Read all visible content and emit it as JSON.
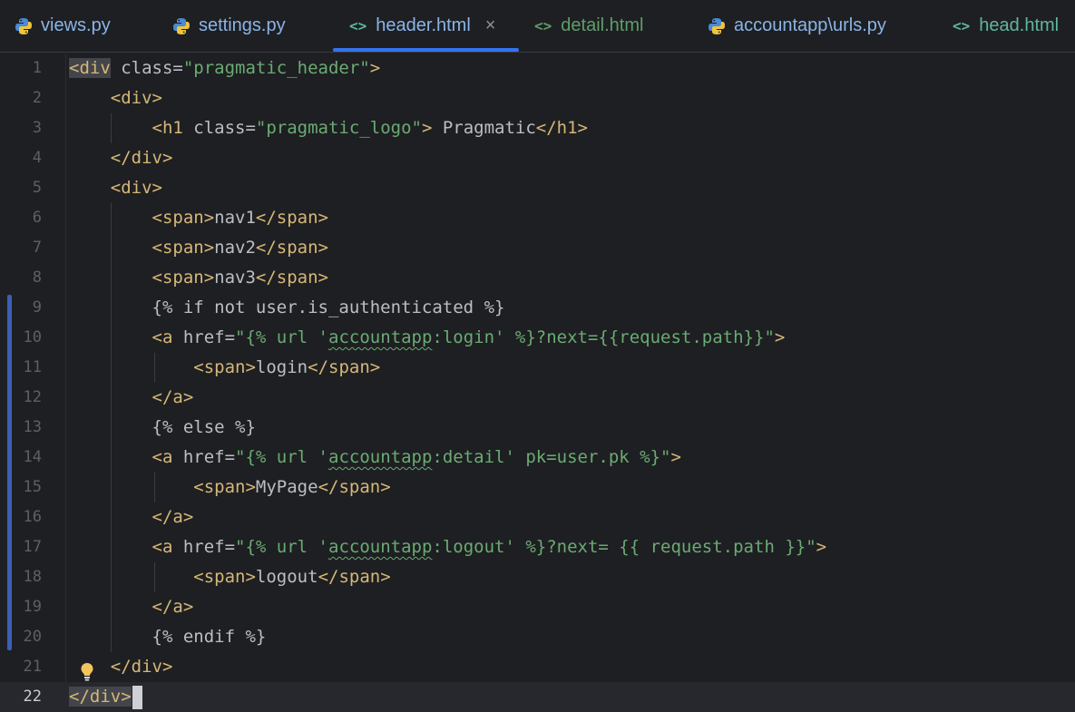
{
  "tabs": [
    {
      "label": "views.py",
      "icon": "python-icon"
    },
    {
      "label": "settings.py",
      "icon": "python-icon"
    },
    {
      "label": "header.html",
      "icon": "html-icon",
      "active": true,
      "close": "×"
    },
    {
      "label": "detail.html",
      "icon": "html-icon"
    },
    {
      "label": "accountapp\\urls.py",
      "icon": "python-icon"
    },
    {
      "label": "head.html",
      "icon": "html-icon"
    }
  ],
  "html_icon_glyph": "<>",
  "editor": {
    "current_line": 22,
    "line_numbers": [
      "1",
      "2",
      "3",
      "4",
      "5",
      "6",
      "7",
      "8",
      "9",
      "10",
      "11",
      "12",
      "13",
      "14",
      "15",
      "16",
      "17",
      "18",
      "19",
      "20",
      "21",
      "22"
    ],
    "lines": {
      "l1_tag": "<div",
      "l1_attr": " class=",
      "l1_str": "\"pragmatic_header\"",
      "l1_end": ">",
      "l2": "<div>",
      "l3_tag": "<h1",
      "l3_attr": " class=",
      "l3_str": "\"pragmatic_logo\"",
      "l3_end": ">",
      "l3_txt": " Pragmatic",
      "l3_close": "</h1>",
      "l4": "</div>",
      "l5": "<div>",
      "l6_open": "<span>",
      "l6_txt": "nav1",
      "l6_close": "</span>",
      "l7_txt": "nav2",
      "l8_txt": "nav3",
      "l9": "{% if not user.is_authenticated %}",
      "l10_tag": "<a",
      "l10_attr": " href=",
      "l10_s1": "\"{% url '",
      "l10_sq": "accountapp",
      "l10_s2": ":login' %}?next={{request.path}}\"",
      "l10_end": ">",
      "l11_txt": "login",
      "l12": "</a>",
      "l13": "{% else %}",
      "l14_s1": "\"{% url '",
      "l14_sq": "accountapp",
      "l14_s2": ":detail' pk=user.pk %}\"",
      "l15_txt": "MyPage",
      "l17_s1": "\"{% url '",
      "l17_sq": "accountapp",
      "l17_s2": ":logout' %}?next= {{ request.path }}\"",
      "l18_txt": "logout",
      "l20": "{% endif %}",
      "l21": "</div>",
      "l22": "</div>"
    }
  }
}
